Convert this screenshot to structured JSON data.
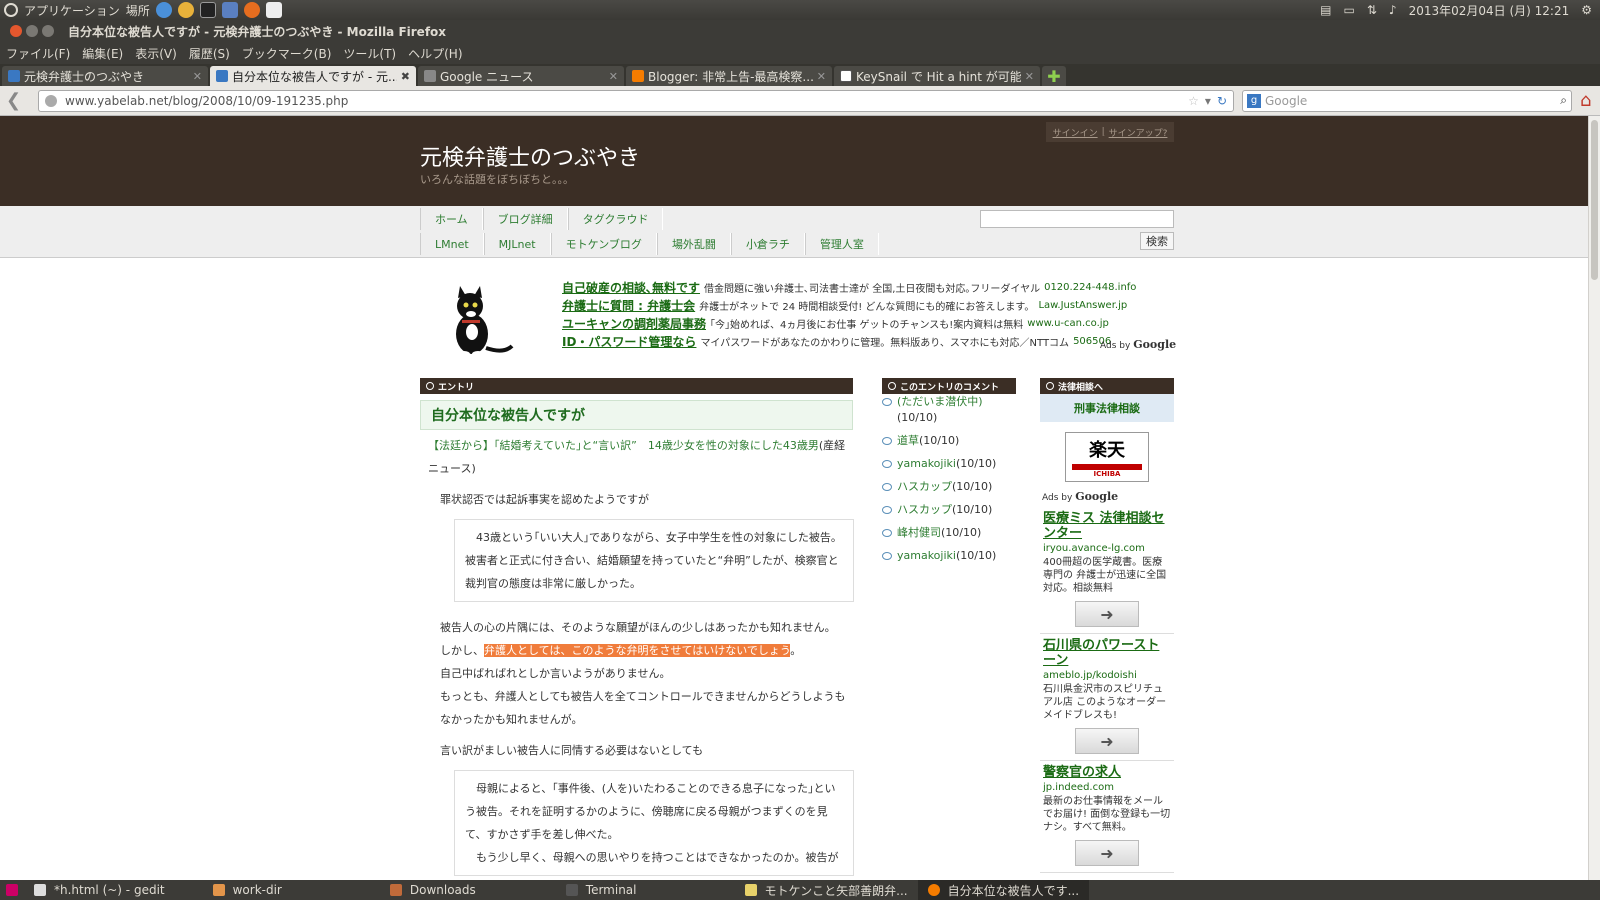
{
  "top_panel": {
    "applications": "アプリケーション",
    "places": "場所",
    "datetime": "2013年02月04日 (月) 12:21"
  },
  "window": {
    "title": "自分本位な被告人ですが - 元検弁護士のつぶやき - Mozilla Firefox"
  },
  "menu": [
    "ファイル(F)",
    "編集(E)",
    "表示(V)",
    "履歴(S)",
    "ブックマーク(B)",
    "ツール(T)",
    "ヘルプ(H)"
  ],
  "tabs": [
    {
      "label": "元検弁護士のつぶやき",
      "color": "#3a78c2"
    },
    {
      "label": "自分本位な被告人ですが - 元...",
      "color": "#3a78c2"
    },
    {
      "label": "Google ニュース",
      "color": "#888888"
    },
    {
      "label": "Blogger: 非常上告-最高検察...",
      "color": "#f57c00"
    },
    {
      "label": "KeySnail で Hit a hint が可能...",
      "color": "#555555"
    }
  ],
  "nav": {
    "url": "www.yabelab.net/blog/2008/10/09-191235.php",
    "search_placeholder": "Google"
  },
  "site": {
    "title": "元検弁護士のつぶやき",
    "subtitle": "いろんな話題をぼちぼちと。。。",
    "signin": "サインイン",
    "sep": "|",
    "signup": "サインアップ?",
    "nav_row1": [
      "ホーム",
      "ブログ詳細",
      "タグクラウド"
    ],
    "nav_row2": [
      "LMnet",
      "MJLnet",
      "モトケンブログ",
      "場外乱闘",
      "小倉ラチ",
      "管理人室"
    ],
    "search_button": "検索"
  },
  "ads_top": [
    {
      "headline": "自己破産の相談､無料です",
      "text": "借金問題に強い弁護士､司法書士達が 全国,土日夜間も対応｡フリーダイヤル",
      "url": "0120.224-448.info"
    },
    {
      "headline": "弁護士に質問 : 弁護士会",
      "text": "弁護士がネットで 24 時間相談受付! どんな質問にも的確にお答えします。",
      "url": "Law.JustAnswer.jp"
    },
    {
      "headline": "ユーキャンの調剤薬局事務",
      "text": "｢今｣始めれば、4ヵ月後にお仕事 ゲットのチャンスも!案内資料は無料",
      "url": "www.u-can.co.jp"
    },
    {
      "headline": "ID・パスワード管理なら",
      "text": "マイパスワードがあなたのかわりに管理。無料版あり、スマホにも対応／NTTコム",
      "url": "506506"
    }
  ],
  "ads_by": "Ads by",
  "ads_google": "Google",
  "entry": {
    "header": "エントリ",
    "title": "自分本位な被告人ですが",
    "source_link": "【法廷から】｢結婚考えていた｣と“言い訳”　14歳少女を性の対象にした43歳男",
    "source_paper": "(産経ニュース)",
    "p1": "罪状認否では起訴事実を認めたようですが",
    "quote1": "　43歳という｢いい大人｣でありながら、女子中学生を性の対象にした被告。被害者と正式に付き合い、結婚願望を持っていたと“弁明”したが、検察官と裁判官の態度は非常に厳しかった。",
    "p2": "被告人の心の片隅には、そのような願望がほんの少しはあったかも知れません。",
    "p3_pre": "しかし、",
    "p3_hl": "弁護人としては、このような弁明をさせてはいけないでしょう",
    "p3_post": "。",
    "p4": "自己中ばればれとしか言いようがありません。",
    "p5": "もっとも、弁護人としても被告人を全てコントロールできませんからどうしようもなかったかも知れませんが。",
    "p6": "言い訳がましい被告人に同情する必要はないとしても",
    "quote2": "　母親によると、｢事件後、(人を)いたわることのできる息子になった｣という被告。それを証明するかのように、傍聴席に戻る母親がつまずくのを見て、すかさず手を差し伸べた。",
    "quote2_cont": "　もう少し早く、母親への思いやりを持つことはできなかったのか。被告が"
  },
  "comments": {
    "header": "このエントリのコメント",
    "items": [
      {
        "who": "(ただいま潜伏中)",
        "date": "(10/10)"
      },
      {
        "who": "道草",
        "date": "(10/10)"
      },
      {
        "who": "yamakojiki",
        "date": "(10/10)"
      },
      {
        "who": "ハスカップ",
        "date": "(10/10)"
      },
      {
        "who": "ハスカップ",
        "date": "(10/10)"
      },
      {
        "who": "峰村健司",
        "date": "(10/10)"
      },
      {
        "who": "yamakojiki",
        "date": "(10/10)"
      }
    ]
  },
  "legal": {
    "header": "法律相談へ",
    "top": "刑事法律相談",
    "rakuten": "楽天",
    "rakuten_sub": "ICHIBA",
    "ads": [
      {
        "headline": "医療ミス 法律相談センター",
        "url": "iryou.avance-lg.com",
        "text": "400冊超の医学蔵書。医療専門の 弁護士が迅速に全国対応。相談無料"
      },
      {
        "headline": "石川県のパワーストーン",
        "url": "ameblo.jp/kodoishi",
        "text": "石川県金沢市のスピリチュアル店 このようなオーダーメイドブレスも!"
      },
      {
        "headline": "警察官の求人",
        "url": "jp.indeed.com",
        "text": "最新のお仕事情報をメールでお届け! 面倒な登録も一切ナシ。すべて無料。"
      }
    ]
  },
  "taskbar": [
    {
      "label": "*h.html (~) - gedit",
      "color": "#dddddd"
    },
    {
      "label": "work-dir",
      "color": "#e3954a"
    },
    {
      "label": "Downloads",
      "color": "#c06a3a"
    },
    {
      "label": "Terminal",
      "color": "#555555"
    },
    {
      "label": "モトケンこと矢部善朗弁...",
      "color": "#e8d26a"
    },
    {
      "label": "自分本位な被告人です...",
      "color": "#f57c00"
    }
  ]
}
